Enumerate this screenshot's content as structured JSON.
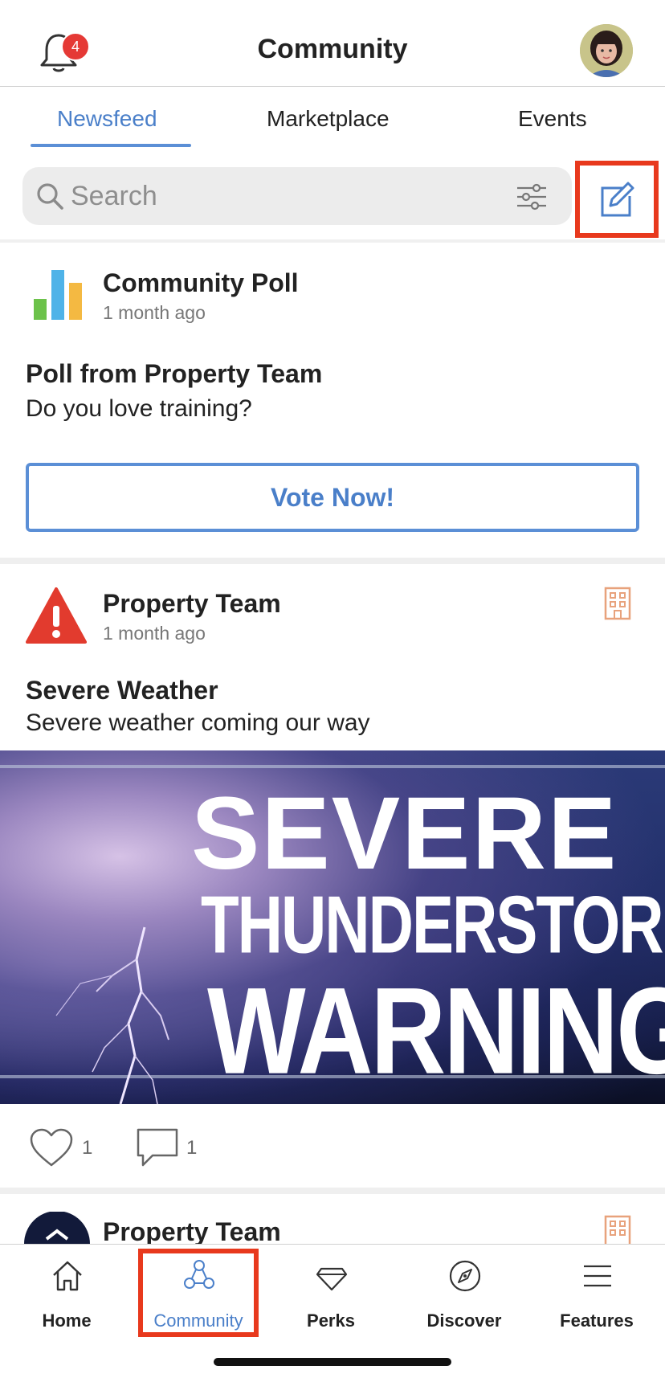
{
  "header": {
    "title": "Community",
    "notification_count": "4"
  },
  "tabs": [
    {
      "label": "Newsfeed",
      "active": true
    },
    {
      "label": "Marketplace",
      "active": false
    },
    {
      "label": "Events",
      "active": false
    }
  ],
  "search": {
    "placeholder": "Search",
    "value": ""
  },
  "posts": [
    {
      "author": "Community Poll",
      "time": "1 month ago",
      "heading": "Poll from Property Team",
      "body": "Do you love training?",
      "button_label": "Vote Now!"
    },
    {
      "author": "Property Team",
      "time": "1 month ago",
      "heading": "Severe Weather",
      "body": "Severe weather coming our way",
      "image_text": [
        "SEVERE",
        "THUNDERSTORM",
        "WARNING"
      ],
      "likes": "1",
      "comments": "1"
    },
    {
      "author": "Property Team"
    }
  ],
  "bottom_nav": [
    {
      "label": "Home",
      "icon": "home-icon",
      "active": false
    },
    {
      "label": "Community",
      "icon": "community-icon",
      "active": true
    },
    {
      "label": "Perks",
      "icon": "diamond-icon",
      "active": false
    },
    {
      "label": "Discover",
      "icon": "compass-icon",
      "active": false
    },
    {
      "label": "Features",
      "icon": "menu-icon",
      "active": false
    }
  ],
  "colors": {
    "accent": "#4a7fc9",
    "highlight": "#e8391d",
    "badge": "#e53935",
    "building_icon": "#e8a27c"
  }
}
